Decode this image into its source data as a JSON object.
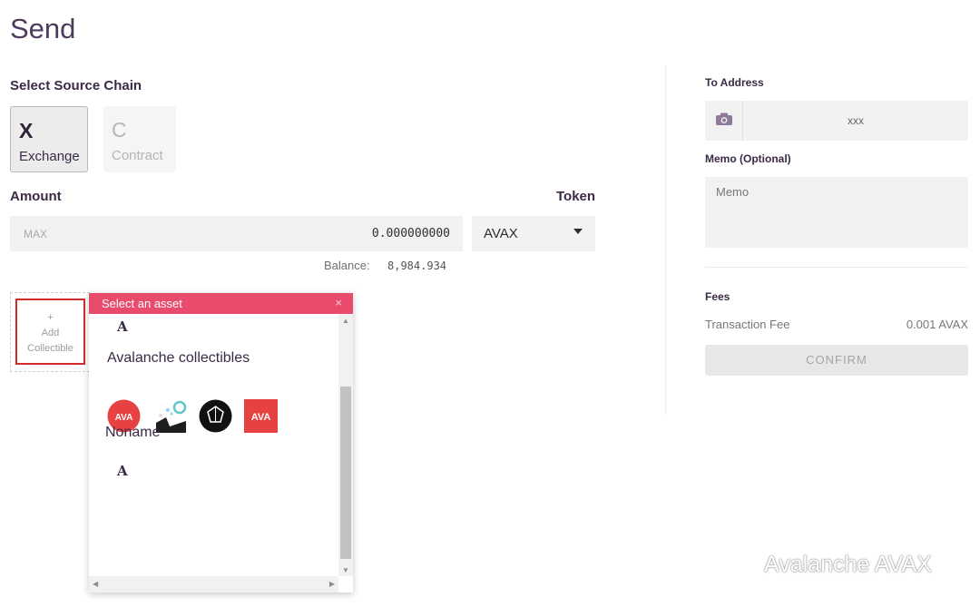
{
  "page_title": "Send",
  "source_chain": {
    "label": "Select Source Chain",
    "options": [
      {
        "letter": "X",
        "name": "Exchange",
        "selected": true
      },
      {
        "letter": "C",
        "name": "Contract",
        "selected": false
      }
    ]
  },
  "amount": {
    "label": "Amount",
    "max_label": "MAX",
    "value": "0.000000000",
    "balance_label": "Balance:",
    "balance_value": "8,984.934"
  },
  "token": {
    "label": "Token",
    "selected": "AVAX"
  },
  "collectible": {
    "plus": "+",
    "label_line1": "Add",
    "label_line2": "Collectible"
  },
  "asset_popup": {
    "title": "Select an asset",
    "close": "×",
    "top_letter": "A",
    "groups": [
      {
        "name": "Avalanche collectibles"
      },
      {
        "name": "Noname",
        "letter": "A"
      }
    ]
  },
  "send_form": {
    "to_address_label": "To Address",
    "to_address_value": "xxx",
    "memo_label": "Memo (Optional)",
    "memo_placeholder": "Memo",
    "fees_label": "Fees",
    "transaction_fee_label": "Transaction Fee",
    "transaction_fee_value": "0.001 AVAX",
    "confirm_label": "CONFIRM"
  },
  "watermark": "Avalanche AVAX",
  "colors": {
    "accent": "#e94b6c",
    "title_text": "#4e3b5c",
    "highlight_border": "#d22b2b"
  }
}
